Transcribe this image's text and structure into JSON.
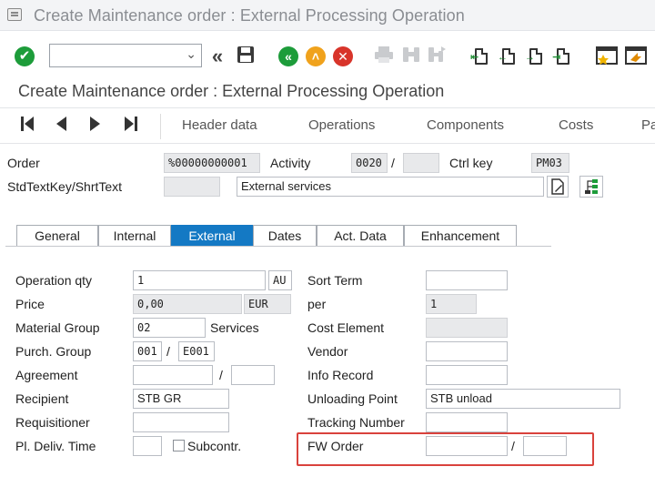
{
  "window": {
    "title": "Create Maintenance order : External Processing Operation"
  },
  "toolbar": {
    "command_value": "",
    "icons": [
      "check-icon",
      "back-double-icon",
      "save-icon",
      "back-icon",
      "exit-icon",
      "cancel-icon",
      "print-icon",
      "find-icon",
      "find-next-icon",
      "first-page-icon",
      "prev-page-icon",
      "next-page-icon",
      "last-page-icon",
      "new-session-icon",
      "shortcut-icon"
    ]
  },
  "screen": {
    "title": "Create Maintenance order : External Processing Operation"
  },
  "nav": {
    "tabs": [
      "Header data",
      "Operations",
      "Components",
      "Costs",
      "Pa"
    ]
  },
  "header": {
    "order_label": "Order",
    "order_value": "%00000000001",
    "activity_label": "Activity",
    "activity_value": "0020",
    "activity_sep": "/",
    "activity_sub_value": "",
    "ctrl_key_label": "Ctrl key",
    "ctrl_key_value": "PM03",
    "stdtext_label": "StdTextKey/ShrtText",
    "stdtext_key_value": "",
    "short_text_value": "External services"
  },
  "tabs": [
    "General",
    "Internal",
    "External",
    "Dates",
    "Act. Data",
    "Enhancement"
  ],
  "active_tab": "External",
  "form": {
    "operation_qty_label": "Operation qty",
    "operation_qty_value": "1",
    "operation_qty_unit": "AU",
    "price_label": "Price",
    "price_value": "0,00",
    "price_currency": "EUR",
    "material_group_label": "Material Group",
    "material_group_value": "02",
    "material_group_text": "Services",
    "purch_group_label": "Purch. Group",
    "purch_group_value": "001",
    "purch_org_value": "E001",
    "agreement_label": "Agreement",
    "agreement_value": "",
    "agreement_item_value": "",
    "recipient_label": "Recipient",
    "recipient_value": "STB GR",
    "requisitioner_label": "Requisitioner",
    "requisitioner_value": "",
    "pl_deliv_time_label": "Pl. Deliv. Time",
    "pl_deliv_time_value": "",
    "subcontr_label": "Subcontr.",
    "subcontr_checked": false,
    "sort_term_label": "Sort Term",
    "sort_term_value": "",
    "per_label": "per",
    "per_value": "1",
    "cost_element_label": "Cost Element",
    "cost_element_value": "",
    "vendor_label": "Vendor",
    "vendor_value": "",
    "info_record_label": "Info Record",
    "info_record_value": "",
    "unloading_point_label": "Unloading Point",
    "unloading_point_value": "STB unload",
    "tracking_number_label": "Tracking Number",
    "tracking_number_value": "",
    "fw_order_label": "FW Order",
    "fw_order_value": "",
    "fw_order_item_value": "",
    "slash": "/"
  },
  "colors": {
    "active_tab": "#1479c4",
    "highlight_box": "#d9423c",
    "ok_green": "#1d9c3a",
    "exit_orange": "#f0a21c",
    "cancel_red": "#d8342a"
  }
}
